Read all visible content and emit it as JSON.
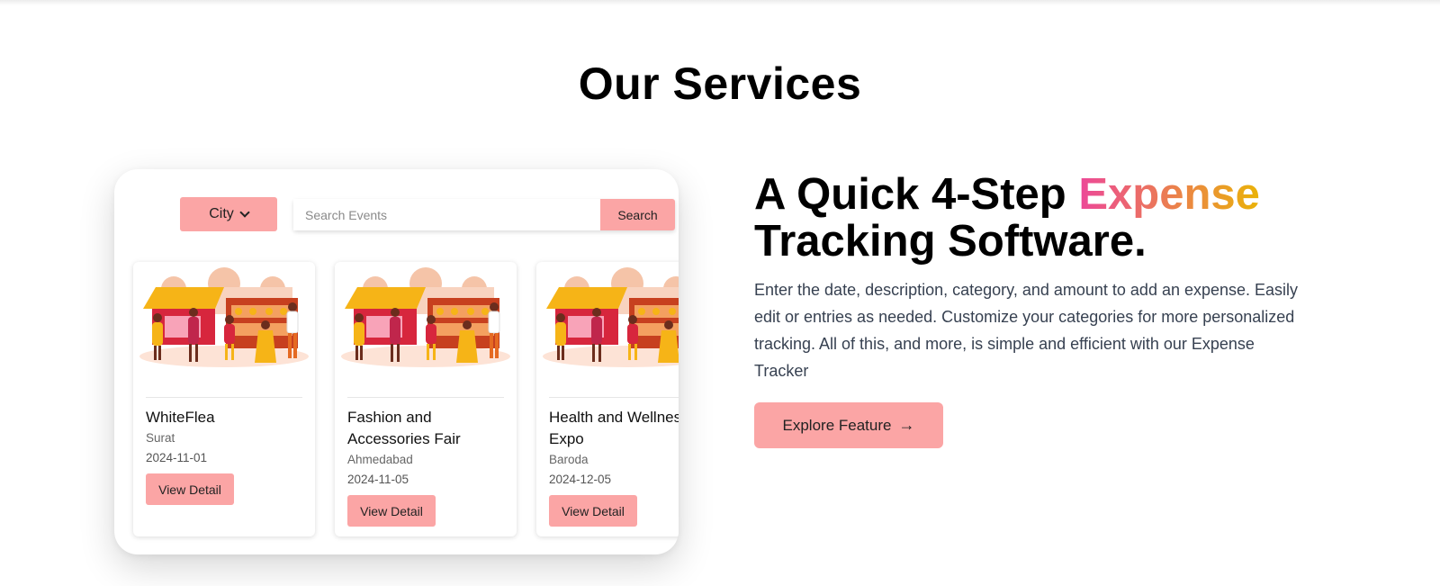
{
  "section_title": "Our Services",
  "preview": {
    "city_button": "City",
    "search_placeholder": "Search Events",
    "search_button": "Search",
    "events": [
      {
        "title": "WhiteFlea",
        "city": "Surat",
        "date": "2024-11-01",
        "button": "View Detail"
      },
      {
        "title": "Fashion and Accessories Fair",
        "city": "Ahmedabad",
        "date": "2024-11-05",
        "button": "View Detail"
      },
      {
        "title": "Health and Wellness Expo",
        "city": "Baroda",
        "date": "2024-12-05",
        "button": "View Detail"
      }
    ]
  },
  "hero": {
    "headline_start": "A Quick 4-Step",
    "headline_highlight": "Expense",
    "headline_end": "Tracking Software.",
    "description": "Enter the date, description, category, and amount to add an expense. Easily edit or entries as needed. Customize your categories for more personalized tracking. All of this, and more, is simple and efficient with our Expense Tracker",
    "explore_button": "Explore Feature"
  },
  "colors": {
    "accent": "#fba5a5",
    "gradient_start": "#ec4899",
    "gradient_end": "#eab308"
  },
  "icons": {
    "city_chevron": "chevron-down-icon",
    "explore_arrow": "arrow-right-icon",
    "event_image": "market-illustration"
  }
}
